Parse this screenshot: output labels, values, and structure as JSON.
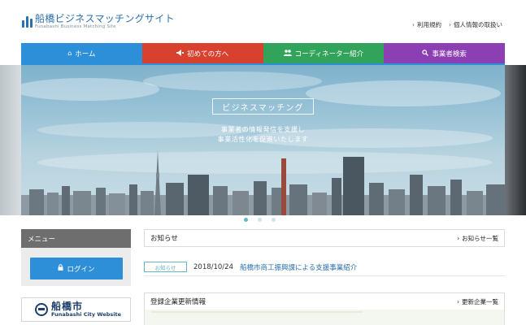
{
  "header": {
    "site_title": "船橋ビジネスマッチングサイト",
    "site_subtitle": "Funabashi Business Matching Site",
    "links": [
      "利用規約",
      "個人情報の取扱い"
    ]
  },
  "nav": {
    "items": [
      {
        "label": "ホーム",
        "icon": "home-icon",
        "color": "#2d8fd8"
      },
      {
        "label": "初めての方へ",
        "icon": "megaphone-icon",
        "color": "#d9412f"
      },
      {
        "label": "コーディネーター紹介",
        "icon": "users-icon",
        "color": "#31a35a"
      },
      {
        "label": "事業者検索",
        "icon": "search-icon",
        "color": "#8b3fb2"
      }
    ]
  },
  "hero": {
    "title": "ビジネスマッチング",
    "line1": "事業者の情報発信を支援し",
    "line2": "事業活性化を促進いたします",
    "slide_count": 3,
    "active_slide": 1
  },
  "sidebar": {
    "menu_title": "メニュー",
    "login_label": "ログイン",
    "banner_main": "船橋市",
    "banner_sub": "Funabashi City Website"
  },
  "news": {
    "title": "お知らせ",
    "more_label": "お知らせ一覧",
    "items": [
      {
        "badge": "お知らせ",
        "date": "2018/10/24",
        "text": "船橋市商工振興課による支援事業紹介"
      }
    ]
  },
  "companies": {
    "title": "登録企業更新情報",
    "more_label": "更新企業一覧"
  },
  "colors": {
    "accent": "#2d8fd8",
    "brand_text": "#2a6fb0",
    "badge": "#63b7c9"
  }
}
